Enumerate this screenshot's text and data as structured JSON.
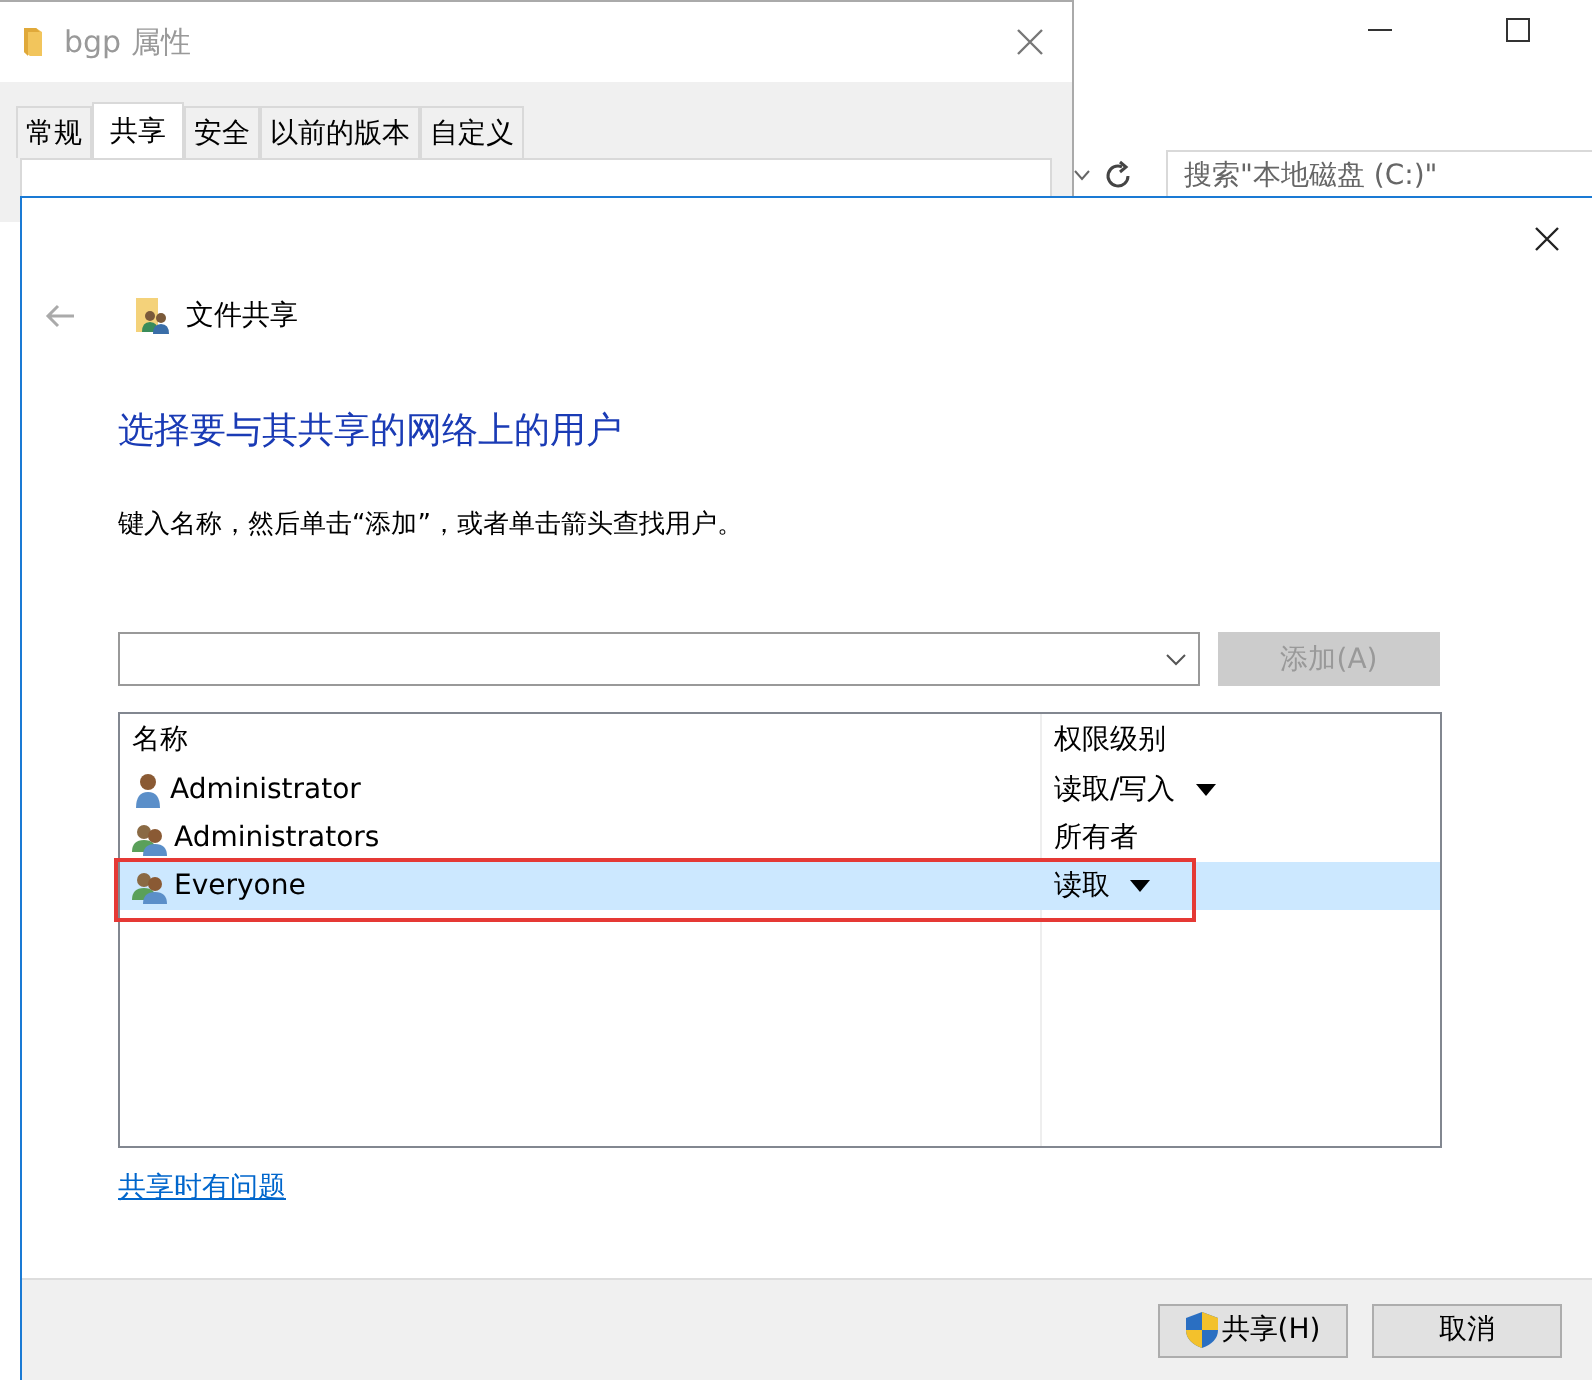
{
  "explorer": {
    "search": {
      "placeholder": "搜索\"本地磁盘 (C:)\""
    }
  },
  "properties_window": {
    "title": "bgp 属性",
    "tabs": [
      {
        "label": "常规",
        "selected": false
      },
      {
        "label": "共享",
        "selected": true
      },
      {
        "label": "安全",
        "selected": false
      },
      {
        "label": "以前的版本",
        "selected": false
      },
      {
        "label": "自定义",
        "selected": false
      }
    ]
  },
  "sharing_dialog": {
    "header": "文件共享",
    "heading": "选择要与其共享的网络上的用户",
    "instruction": "键入名称，然后单击“添加”，或者单击箭头查找用户。",
    "add_button": {
      "label": "添加(A)",
      "disabled": true
    },
    "table": {
      "columns": [
        "名称",
        "权限级别"
      ],
      "rows": [
        {
          "kind": "user",
          "name": "Administrator",
          "permission": "读取/写入",
          "has_menu": true,
          "selected": false
        },
        {
          "kind": "group",
          "name": "Administrators",
          "permission": "所有者",
          "has_menu": false,
          "selected": false
        },
        {
          "kind": "group",
          "name": "Everyone",
          "permission": "读取",
          "has_menu": true,
          "selected": true
        }
      ]
    },
    "help_link": "共享时有问题",
    "buttons": [
      {
        "label": "共享(H)",
        "shield": true
      },
      {
        "label": "取消",
        "shield": false
      }
    ]
  }
}
